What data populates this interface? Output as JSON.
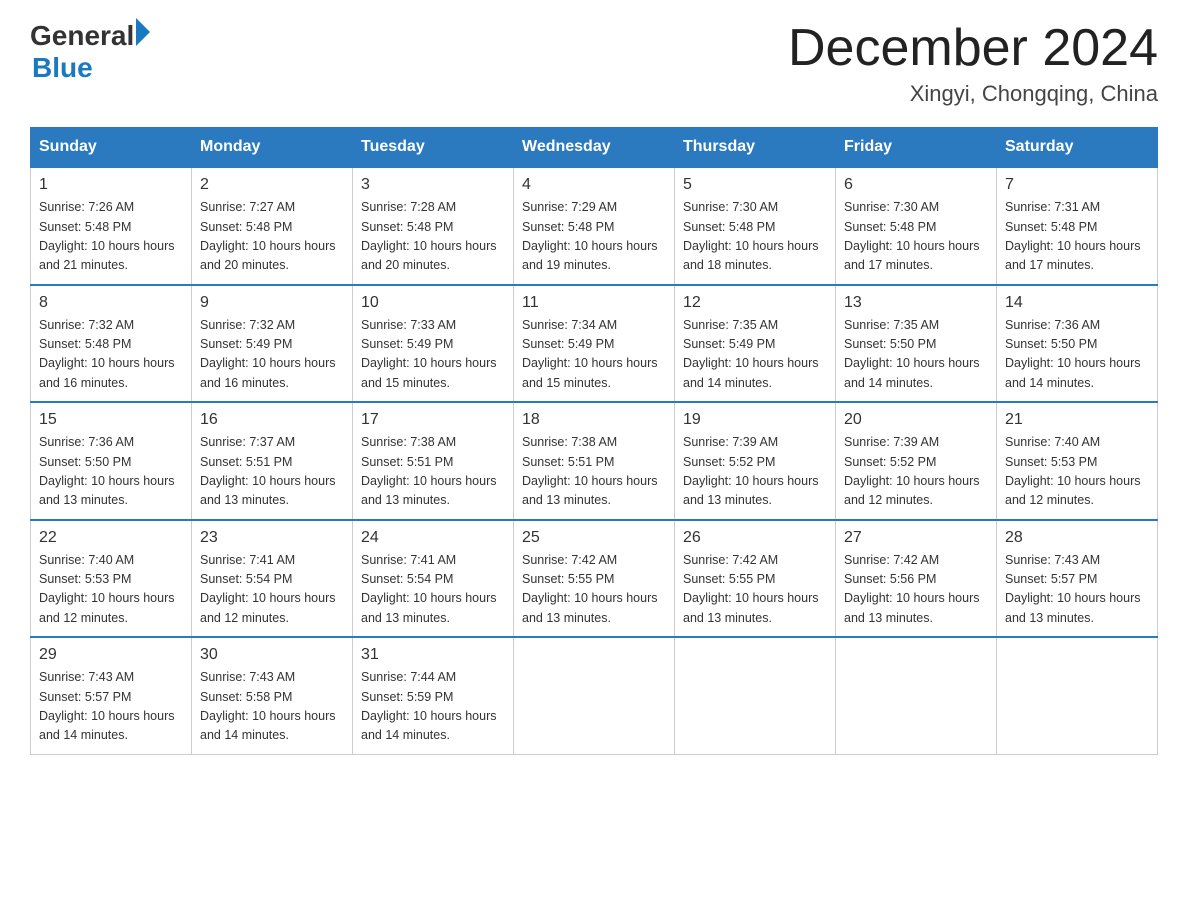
{
  "header": {
    "logo_general": "General",
    "logo_blue": "Blue",
    "month_title": "December 2024",
    "location": "Xingyi, Chongqing, China"
  },
  "days_of_week": [
    "Sunday",
    "Monday",
    "Tuesday",
    "Wednesday",
    "Thursday",
    "Friday",
    "Saturday"
  ],
  "weeks": [
    [
      {
        "day": "1",
        "sunrise": "7:26 AM",
        "sunset": "5:48 PM",
        "daylight": "10 hours and 21 minutes."
      },
      {
        "day": "2",
        "sunrise": "7:27 AM",
        "sunset": "5:48 PM",
        "daylight": "10 hours and 20 minutes."
      },
      {
        "day": "3",
        "sunrise": "7:28 AM",
        "sunset": "5:48 PM",
        "daylight": "10 hours and 20 minutes."
      },
      {
        "day": "4",
        "sunrise": "7:29 AM",
        "sunset": "5:48 PM",
        "daylight": "10 hours and 19 minutes."
      },
      {
        "day": "5",
        "sunrise": "7:30 AM",
        "sunset": "5:48 PM",
        "daylight": "10 hours and 18 minutes."
      },
      {
        "day": "6",
        "sunrise": "7:30 AM",
        "sunset": "5:48 PM",
        "daylight": "10 hours and 17 minutes."
      },
      {
        "day": "7",
        "sunrise": "7:31 AM",
        "sunset": "5:48 PM",
        "daylight": "10 hours and 17 minutes."
      }
    ],
    [
      {
        "day": "8",
        "sunrise": "7:32 AM",
        "sunset": "5:48 PM",
        "daylight": "10 hours and 16 minutes."
      },
      {
        "day": "9",
        "sunrise": "7:32 AM",
        "sunset": "5:49 PM",
        "daylight": "10 hours and 16 minutes."
      },
      {
        "day": "10",
        "sunrise": "7:33 AM",
        "sunset": "5:49 PM",
        "daylight": "10 hours and 15 minutes."
      },
      {
        "day": "11",
        "sunrise": "7:34 AM",
        "sunset": "5:49 PM",
        "daylight": "10 hours and 15 minutes."
      },
      {
        "day": "12",
        "sunrise": "7:35 AM",
        "sunset": "5:49 PM",
        "daylight": "10 hours and 14 minutes."
      },
      {
        "day": "13",
        "sunrise": "7:35 AM",
        "sunset": "5:50 PM",
        "daylight": "10 hours and 14 minutes."
      },
      {
        "day": "14",
        "sunrise": "7:36 AM",
        "sunset": "5:50 PM",
        "daylight": "10 hours and 14 minutes."
      }
    ],
    [
      {
        "day": "15",
        "sunrise": "7:36 AM",
        "sunset": "5:50 PM",
        "daylight": "10 hours and 13 minutes."
      },
      {
        "day": "16",
        "sunrise": "7:37 AM",
        "sunset": "5:51 PM",
        "daylight": "10 hours and 13 minutes."
      },
      {
        "day": "17",
        "sunrise": "7:38 AM",
        "sunset": "5:51 PM",
        "daylight": "10 hours and 13 minutes."
      },
      {
        "day": "18",
        "sunrise": "7:38 AM",
        "sunset": "5:51 PM",
        "daylight": "10 hours and 13 minutes."
      },
      {
        "day": "19",
        "sunrise": "7:39 AM",
        "sunset": "5:52 PM",
        "daylight": "10 hours and 13 minutes."
      },
      {
        "day": "20",
        "sunrise": "7:39 AM",
        "sunset": "5:52 PM",
        "daylight": "10 hours and 12 minutes."
      },
      {
        "day": "21",
        "sunrise": "7:40 AM",
        "sunset": "5:53 PM",
        "daylight": "10 hours and 12 minutes."
      }
    ],
    [
      {
        "day": "22",
        "sunrise": "7:40 AM",
        "sunset": "5:53 PM",
        "daylight": "10 hours and 12 minutes."
      },
      {
        "day": "23",
        "sunrise": "7:41 AM",
        "sunset": "5:54 PM",
        "daylight": "10 hours and 12 minutes."
      },
      {
        "day": "24",
        "sunrise": "7:41 AM",
        "sunset": "5:54 PM",
        "daylight": "10 hours and 13 minutes."
      },
      {
        "day": "25",
        "sunrise": "7:42 AM",
        "sunset": "5:55 PM",
        "daylight": "10 hours and 13 minutes."
      },
      {
        "day": "26",
        "sunrise": "7:42 AM",
        "sunset": "5:55 PM",
        "daylight": "10 hours and 13 minutes."
      },
      {
        "day": "27",
        "sunrise": "7:42 AM",
        "sunset": "5:56 PM",
        "daylight": "10 hours and 13 minutes."
      },
      {
        "day": "28",
        "sunrise": "7:43 AM",
        "sunset": "5:57 PM",
        "daylight": "10 hours and 13 minutes."
      }
    ],
    [
      {
        "day": "29",
        "sunrise": "7:43 AM",
        "sunset": "5:57 PM",
        "daylight": "10 hours and 14 minutes."
      },
      {
        "day": "30",
        "sunrise": "7:43 AM",
        "sunset": "5:58 PM",
        "daylight": "10 hours and 14 minutes."
      },
      {
        "day": "31",
        "sunrise": "7:44 AM",
        "sunset": "5:59 PM",
        "daylight": "10 hours and 14 minutes."
      },
      null,
      null,
      null,
      null
    ]
  ],
  "labels": {
    "sunrise": "Sunrise:",
    "sunset": "Sunset:",
    "daylight": "Daylight:"
  }
}
